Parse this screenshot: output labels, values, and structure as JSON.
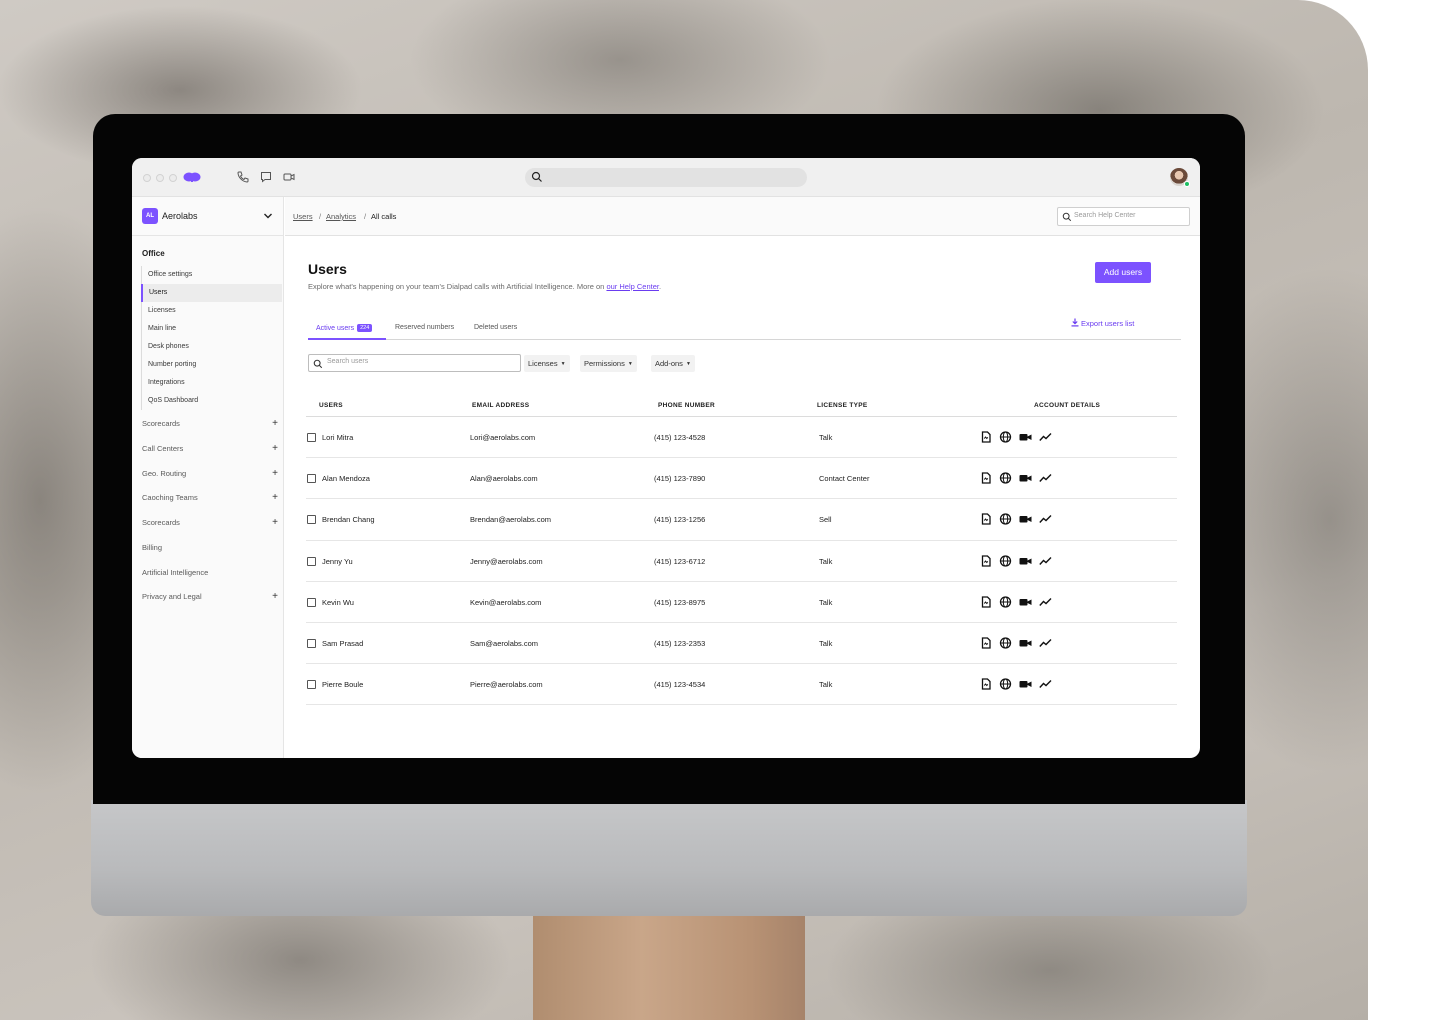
{
  "app": {
    "org_initials": "AL",
    "org_name": "Aerolabs"
  },
  "topbar": {
    "icons": [
      "dialpad-logo-icon",
      "phone-icon",
      "chat-icon",
      "video-icon",
      "search-icon",
      "user-avatar"
    ]
  },
  "breadcrumb": {
    "items": [
      "Users",
      "Analytics",
      "All calls"
    ],
    "separator": "/"
  },
  "help_search": {
    "placeholder": "Search Help Center"
  },
  "sidebar": {
    "section": "Office",
    "sub_items": [
      "Office settings",
      "Users",
      "Licenses",
      "Main line",
      "Desk phones",
      "Number porting",
      "Integrations",
      "QoS Dashboard"
    ],
    "active_sub_item": "Users",
    "nav_items": [
      {
        "label": "Scorecards",
        "expandable": true
      },
      {
        "label": "Call Centers",
        "expandable": true
      },
      {
        "label": "Geo. Routing",
        "expandable": true
      },
      {
        "label": "Caoching Teams",
        "expandable": true
      },
      {
        "label": "Scorecards",
        "expandable": true
      },
      {
        "label": "Billing",
        "expandable": false
      },
      {
        "label": "Artificial Intelligence",
        "expandable": false
      },
      {
        "label": "Privacy and Legal",
        "expandable": true
      }
    ]
  },
  "page": {
    "title": "Users",
    "subtitle": "Explore what's happening on your team's Dialpad calls with Artificial Intelligence. More on",
    "subtitle_link": "our Help Center",
    "subtitle_end": ".",
    "add_button": "Add users"
  },
  "tabs": {
    "items": [
      {
        "label": "Active users",
        "count": "224",
        "active": true
      },
      {
        "label": "Reserved numbers",
        "active": false
      },
      {
        "label": "Deleted users",
        "active": false
      }
    ],
    "export_label": "Export users list"
  },
  "filters": {
    "search_placeholder": "Search users",
    "dropdowns": [
      "Licenses",
      "Permissions",
      "Add-ons"
    ]
  },
  "table": {
    "columns": [
      "USERS",
      "EMAIL ADDRESS",
      "PHONE NUMBER",
      "LICENSE TYPE",
      "ACCOUNT DETAILS"
    ],
    "rows": [
      {
        "name": "Lori Mitra",
        "email": "Lori@aerolabs.com",
        "phone": "(415) 123-4528",
        "license": "Talk"
      },
      {
        "name": "Alan Mendoza",
        "email": "Alan@aerolabs.com",
        "phone": "(415) 123-7890",
        "license": "Contact Center"
      },
      {
        "name": "Brendan Chang",
        "email": "Brendan@aerolabs.com",
        "phone": "(415) 123-1256",
        "license": "Sell"
      },
      {
        "name": "Jenny Yu",
        "email": "Jenny@aerolabs.com",
        "phone": "(415) 123-6712",
        "license": "Talk"
      },
      {
        "name": "Kevin Wu",
        "email": "Kevin@aerolabs.com",
        "phone": "(415) 123-8975",
        "license": "Talk"
      },
      {
        "name": "Sam Prasad",
        "email": "Sam@aerolabs.com",
        "phone": "(415) 123-2353",
        "license": "Talk"
      },
      {
        "name": "Pierre Boule",
        "email": "Pierre@aerolabs.com",
        "phone": "(415) 123-4534",
        "license": "Talk"
      }
    ],
    "account_icons": [
      "document-icon",
      "globe-icon",
      "video-icon",
      "analytics-icon"
    ]
  },
  "colors": {
    "accent": "#7c52ff",
    "link": "#6a3cf0",
    "status_online": "#1dbf63"
  }
}
